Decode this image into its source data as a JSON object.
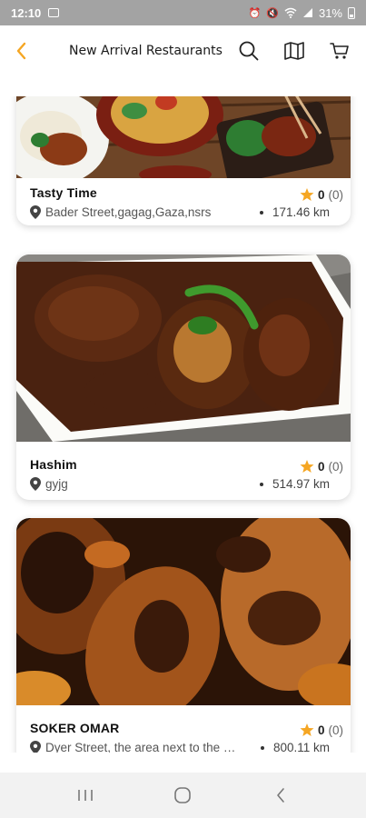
{
  "status": {
    "time": "12:10",
    "battery": "31%"
  },
  "header": {
    "title": "New Arrival Restaurants"
  },
  "restaurants": [
    {
      "name": "Tasty Time",
      "address": "Bader Street,gagag,Gaza,nsrs",
      "distance": "171.46 km",
      "rating": "0",
      "reviews": "(0)"
    },
    {
      "name": "Hashim",
      "address": "gyjg",
      "distance": "514.97 km",
      "rating": "0",
      "reviews": "(0)"
    },
    {
      "name": "SOKER OMAR",
      "address": "Dyer Street, the area next to the mosque",
      "distance": "800.11 km",
      "rating": "0",
      "reviews": "(0)"
    }
  ],
  "colors": {
    "accent": "#f5a623",
    "star": "#f5a623"
  },
  "icons": [
    "back-arrow-icon",
    "search-icon",
    "map-icon",
    "cart-icon",
    "star-icon",
    "location-pin-icon"
  ]
}
